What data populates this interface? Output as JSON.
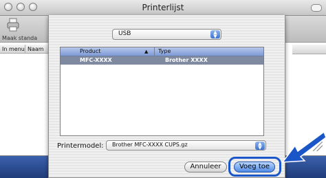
{
  "window": {
    "title": "Printerlijst"
  },
  "toolbar": {
    "add_label": "Maak standa",
    "icon": "printer-icon"
  },
  "columns": {
    "in_menu": "In menu",
    "name": "Naam"
  },
  "sheet": {
    "connection_popup": "USB",
    "table_headers": {
      "product": "Product",
      "sort_indicator": "▲",
      "type": "Type"
    },
    "rows": [
      {
        "product": "MFC-XXXX",
        "type": "Brother XXXX"
      }
    ],
    "printer_model_label": "Printermodel:",
    "printer_model_value": "Brother MFC-XXXX CUPS.gz",
    "cancel_label": "Annuleer",
    "add_label": "Voeg toe"
  },
  "colors": {
    "highlight": "#1a56c8",
    "selection": "#7f8aa0",
    "desktop": "#2b4a8a"
  }
}
